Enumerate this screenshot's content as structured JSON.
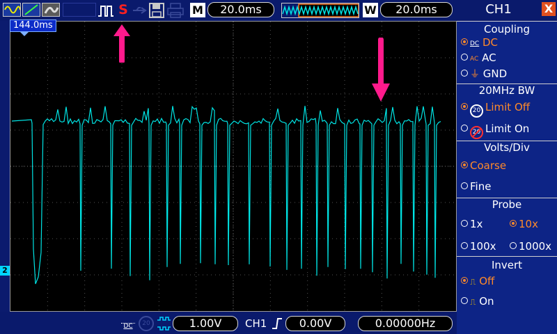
{
  "topbar": {
    "mode_letter": "M",
    "timebase": "20.0ms",
    "window_letter": "W",
    "window_time": "20.0ms",
    "run_status": "S"
  },
  "screen": {
    "trigger_time_tag": "144.0ms",
    "channel_marker": "2"
  },
  "bottombar": {
    "volts_div": "1.00V",
    "trigger_channel": "CH1",
    "trigger_level": "0.00V",
    "frequency": "0.00000Hz"
  },
  "panel": {
    "title": "CH1",
    "close": "X",
    "coupling": {
      "header": "Coupling",
      "options": [
        "DC",
        "AC",
        "GND"
      ],
      "selected": "DC"
    },
    "bandwidth": {
      "header": "20MHz BW",
      "options": [
        "Limit Off",
        "Limit On"
      ],
      "selected": "Limit Off"
    },
    "volts_div": {
      "header": "Volts/Div",
      "options": [
        "Coarse",
        "Fine"
      ],
      "selected": "Coarse"
    },
    "probe": {
      "header": "Probe",
      "options": [
        "1x",
        "10x",
        "100x",
        "1000x"
      ],
      "selected": "10x"
    },
    "invert": {
      "header": "Invert",
      "options": [
        "Off",
        "On"
      ],
      "selected": "Off"
    }
  },
  "colors": {
    "trace": "#00e5e5",
    "selected": "#ff8a2a",
    "annotation_arrow": "#ff1a8c"
  }
}
